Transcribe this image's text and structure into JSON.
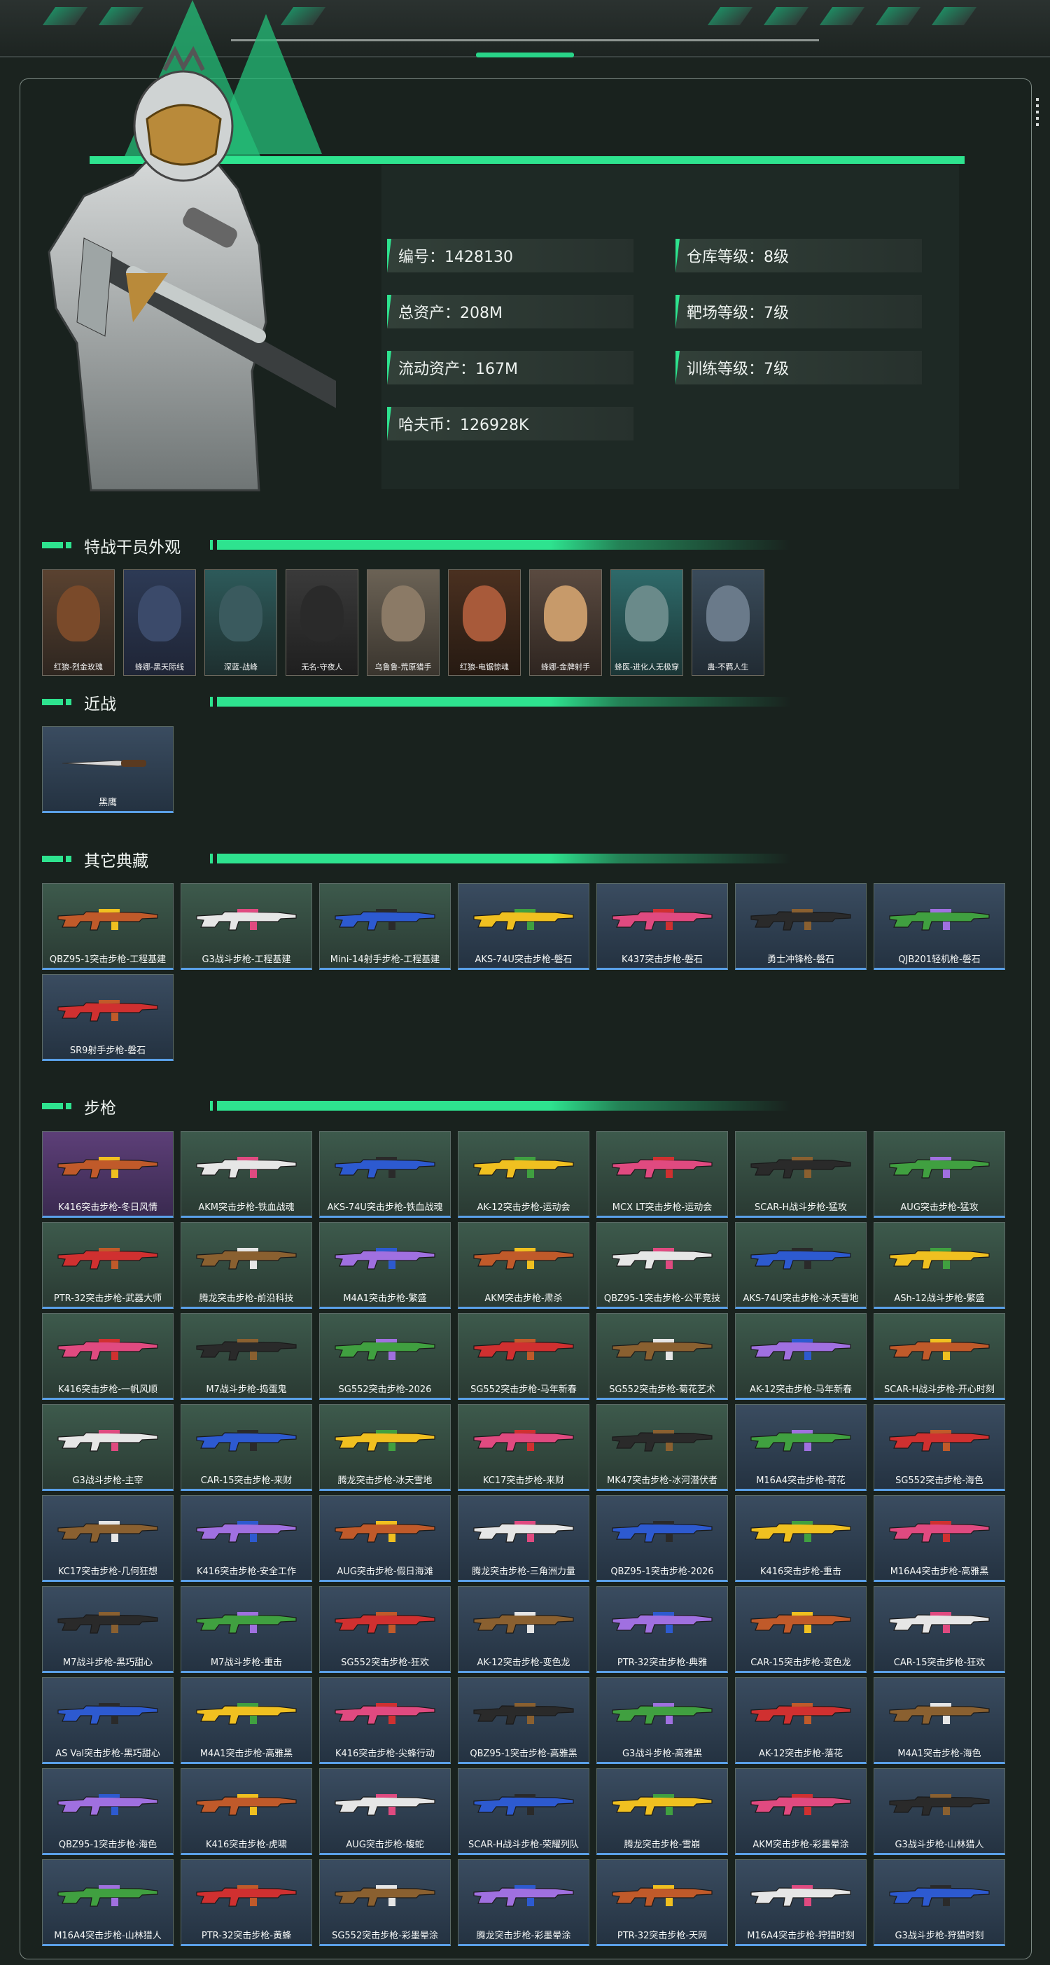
{
  "profile": {
    "stats": [
      {
        "label": "编号：1428130"
      },
      {
        "label": "仓库等级：8级"
      },
      {
        "label": "总资产：208M"
      },
      {
        "label": "靶场等级：7级"
      },
      {
        "label": "流动资产：167M"
      },
      {
        "label": "训练等级：7级"
      },
      {
        "label": "哈夫币：126928K"
      }
    ]
  },
  "sections": {
    "operators": "特战干员外观",
    "melee": "近战",
    "collection": "其它典藏",
    "rifles": "步枪"
  },
  "operators": [
    "红狼-烈金玫瑰",
    "蜂娜-黑天际线",
    "深蓝-战峰",
    "无名-守夜人",
    "乌鲁鲁-荒原猎手",
    "红狼-电锯惊魂",
    "蜂娜-金牌射手",
    "蜂医-进化人无极穿",
    "蛊-不羁人生"
  ],
  "melee": [
    "黑鹰"
  ],
  "collection": [
    "QBZ95-1突击步枪-工程基建",
    "G3战斗步枪-工程基建",
    "Mini-14射手步枪-工程基建",
    "AKS-74U突击步枪-磐石",
    "K437突击步枪-磐石",
    "勇士冲锋枪-磐石",
    "QJB201轻机枪-磐石",
    "SR9射手步枪-磐石"
  ],
  "rifles": [
    "K416突击步枪-冬日风情",
    "AKM突击步枪-铁血战魂",
    "AKS-74U突击步枪-铁血战魂",
    "AK-12突击步枪-运动会",
    "MCX LT突击步枪-运动会",
    "SCAR-H战斗步枪-猛攻",
    "AUG突击步枪-猛攻",
    "PTR-32突击步枪-武器大师",
    "腾龙突击步枪-前沿科技",
    "M4A1突击步枪-繁盛",
    "AKM突击步枪-肃杀",
    "QBZ95-1突击步枪-公平竞技",
    "AKS-74U突击步枪-冰天雪地",
    "ASh-12战斗步枪-繁盛",
    "K416突击步枪-一帆风顺",
    "M7战斗步枪-捣蛋鬼",
    "SG552突击步枪-2026",
    "SG552突击步枪-马年新春",
    "SG552突击步枪-菊花艺术",
    "AK-12突击步枪-马年新春",
    "SCAR-H战斗步枪-开心时刻",
    "G3战斗步枪-主宰",
    "CAR-15突击步枪-来财",
    "腾龙突击步枪-冰天雪地",
    "KC17突击步枪-来财",
    "MK47突击步枪-冰河潜伏者",
    "M16A4突击步枪-荷花",
    "SG552突击步枪-海色",
    "KC17突击步枪-几何狂想",
    "K416突击步枪-安全工作",
    "AUG突击步枪-假日海滩",
    "腾龙突击步枪-三角洲力量",
    "QBZ95-1突击步枪-2026",
    "K416突击步枪-重击",
    "M16A4突击步枪-高雅黑",
    "M7战斗步枪-黑巧甜心",
    "M7战斗步枪-重击",
    "SG552突击步枪-狂欢",
    "AK-12突击步枪-变色龙",
    "PTR-32突击步枪-典雅",
    "CAR-15突击步枪-变色龙",
    "CAR-15突击步枪-狂欢",
    "AS Val突击步枪-黑巧甜心",
    "M4A1突击步枪-高雅黑",
    "K416突击步枪-尖蜂行动",
    "QBZ95-1突击步枪-高雅黑",
    "G3战斗步枪-高雅黑",
    "AK-12突击步枪-落花",
    "M4A1突击步枪-海色",
    "QBZ95-1突击步枪-海色",
    "K416突击步枪-虎啸",
    "AUG突击步枪-蝮蛇",
    "SCAR-H战斗步枪-荣耀列队",
    "腾龙突击步枪-雪崩",
    "AKM突击步枪-彩墨晕涂",
    "G3战斗步枪-山林猎人",
    "M16A4突击步枪-山林猎人",
    "PTR-32突击步枪-黄蜂",
    "SG552突击步枪-彩墨晕涂",
    "腾龙突击步枪-彩墨晕涂",
    "PTR-32突击步枪-天网",
    "M16A4突击步枪-狩猎时刻",
    "G3战斗步枪-狩猎时刻"
  ],
  "colors": {
    "accent": "#2ee38f",
    "card_green": "#3d5a4c",
    "card_blue": "#3a4c60",
    "card_purple": "#5d3f78",
    "card_border": "#5aa0e8"
  }
}
